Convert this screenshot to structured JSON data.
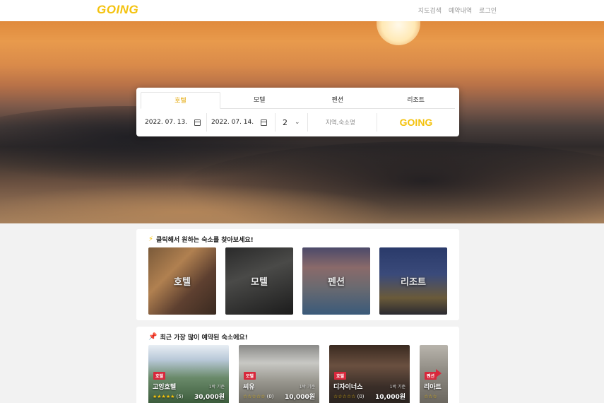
{
  "header": {
    "logo": "GOING",
    "nav": [
      "지도검색",
      "예약내역",
      "로그인"
    ]
  },
  "search": {
    "tabs": [
      "호텔",
      "모텔",
      "펜션",
      "리조트"
    ],
    "active_tab": "호텔",
    "checkin": "2022. 07. 13.",
    "checkout": "2022. 07. 14.",
    "guests": "2",
    "keyword_placeholder": "지역,숙소명",
    "go_button": "GOING"
  },
  "categories": {
    "title": "클릭해서 원하는 숙소를 찾아보세요!",
    "items": [
      "호텔",
      "모텔",
      "펜션",
      "리조트"
    ]
  },
  "popular": {
    "title": "최근 가장 많이 예약된 숙소에요!",
    "items": [
      {
        "badge": "호텔",
        "name": "고잉호텔",
        "unit": "1박 기준",
        "stars": "★★★★★",
        "reviews": "(5)",
        "price": "30,000원"
      },
      {
        "badge": "모텔",
        "name": "씨유",
        "unit": "1박 기준",
        "stars": "☆☆☆☆☆",
        "reviews": "(0)",
        "price": "10,000원"
      },
      {
        "badge": "호텔",
        "name": "디자이너스",
        "unit": "1박 기준",
        "stars": "☆☆☆☆☆",
        "reviews": "(0)",
        "price": "10,000원"
      },
      {
        "badge": "펜션",
        "name": "리아트",
        "unit": "",
        "stars": "☆☆☆",
        "reviews": "",
        "price": ""
      }
    ]
  },
  "colors": {
    "accent": "#f4c20d",
    "badge": "#d8283c"
  }
}
